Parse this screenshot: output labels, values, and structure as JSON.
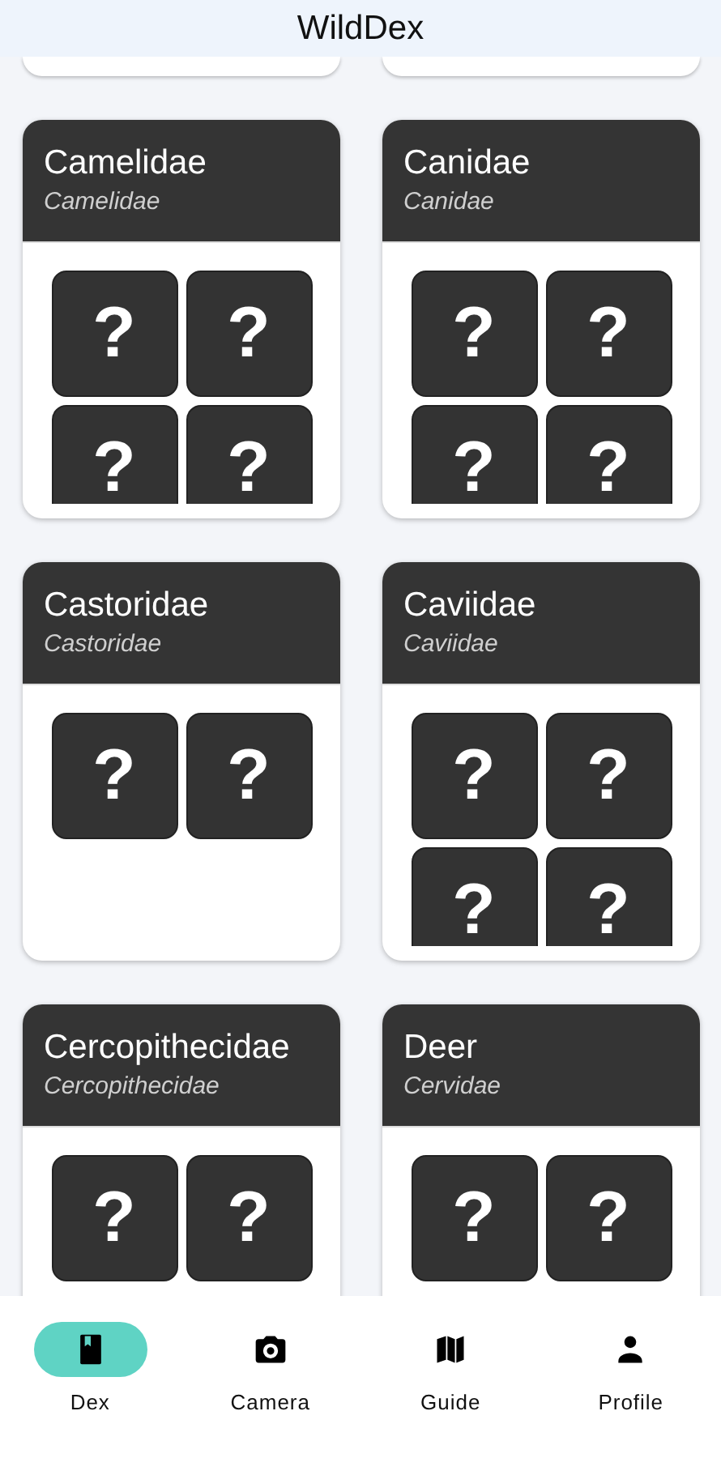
{
  "header": {
    "title": "WildDex"
  },
  "families": [
    {
      "name": "Camelidae",
      "scientific": "Camelidae",
      "species": [
        {
          "label": "?"
        },
        {
          "label": "?"
        },
        {
          "label": "?"
        },
        {
          "label": "?"
        }
      ]
    },
    {
      "name": "Canidae",
      "scientific": "Canidae",
      "species": [
        {
          "label": "?"
        },
        {
          "label": "?"
        },
        {
          "label": "?"
        },
        {
          "label": "?"
        }
      ]
    },
    {
      "name": "Castoridae",
      "scientific": "Castoridae",
      "species": [
        {
          "label": "?"
        },
        {
          "label": "?"
        }
      ]
    },
    {
      "name": "Caviidae",
      "scientific": "Caviidae",
      "species": [
        {
          "label": "?"
        },
        {
          "label": "?"
        },
        {
          "label": "?"
        },
        {
          "label": "?"
        }
      ]
    },
    {
      "name": "Cercopithecidae",
      "scientific": "Cercopithecidae",
      "species": [
        {
          "label": "?"
        },
        {
          "label": "?"
        }
      ]
    },
    {
      "name": "Deer",
      "scientific": "Cervidae",
      "species": [
        {
          "label": "?"
        },
        {
          "label": "?"
        }
      ]
    }
  ],
  "nav": [
    {
      "label": "Dex",
      "selected": true
    },
    {
      "label": "Camera",
      "selected": false
    },
    {
      "label": "Guide",
      "selected": false
    },
    {
      "label": "Profile",
      "selected": false
    }
  ]
}
